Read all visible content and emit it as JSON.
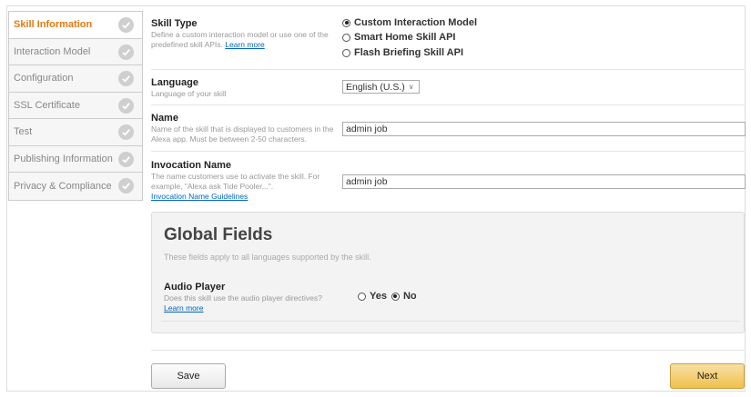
{
  "sidebar": {
    "items": [
      {
        "label": "Skill Information",
        "active": true
      },
      {
        "label": "Interaction Model",
        "active": false
      },
      {
        "label": "Configuration",
        "active": false
      },
      {
        "label": "SSL Certificate",
        "active": false
      },
      {
        "label": "Test",
        "active": false
      },
      {
        "label": "Publishing Information",
        "active": false
      },
      {
        "label": "Privacy & Compliance",
        "active": false
      }
    ]
  },
  "skill_type": {
    "title": "Skill Type",
    "desc": "Define a custom interaction model or use one of the predefined skill APIs.",
    "link": "Learn more",
    "options": [
      {
        "label": "Custom Interaction Model",
        "selected": true
      },
      {
        "label": "Smart Home Skill API",
        "selected": false
      },
      {
        "label": "Flash Briefing Skill API",
        "selected": false
      }
    ]
  },
  "language": {
    "title": "Language",
    "desc": "Language of your skill",
    "value": "English (U.S.)"
  },
  "name": {
    "title": "Name",
    "desc": "Name of the skill that is displayed to customers in the Alexa app. Must be between 2-50 characters.",
    "value": "admin job"
  },
  "invocation": {
    "title": "Invocation Name",
    "desc": "The name customers use to activate the skill. For example, \"Alexa ask Tide Pooler...\".",
    "link": "Invocation Name Guidelines",
    "value": "admin job"
  },
  "global_fields": {
    "title": "Global Fields",
    "subtitle": "These fields apply to all languages supported by the skill.",
    "audio_title": "Audio Player",
    "audio_desc": "Does this skill use the audio player directives?",
    "audio_link": "Learn more",
    "yes_label": "Yes",
    "no_label": "No",
    "selected": "No"
  },
  "buttons": {
    "save": "Save",
    "next": "Next"
  },
  "colors": {
    "active": "#e47911",
    "link": "#0066c0",
    "next_button": "#f0c14b"
  }
}
